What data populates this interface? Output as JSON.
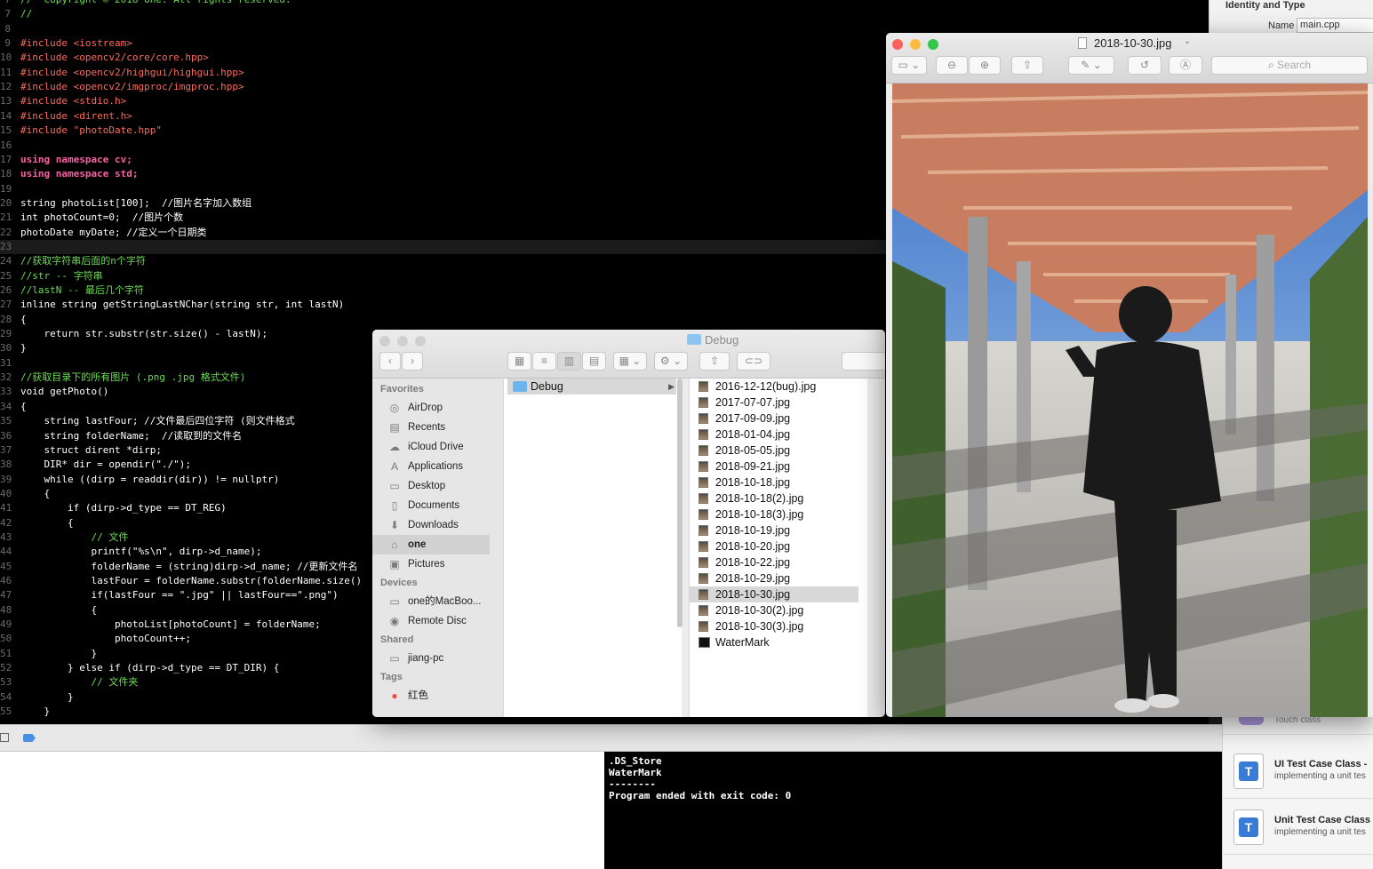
{
  "editor": {
    "lines": [
      {
        "num": "7",
        "text": "//  Copyright © 2018 one. All rights reserved.",
        "cls": "c"
      },
      {
        "num": "7",
        "text": "//",
        "cls": "c"
      },
      {
        "num": "8",
        "text": "",
        "cls": "w"
      },
      {
        "num": "9",
        "text": "#include <iostream>",
        "cls": "p"
      },
      {
        "num": "10",
        "text": "#include <opencv2/core/core.hpp>",
        "cls": "p"
      },
      {
        "num": "11",
        "text": "#include <opencv2/highgui/highgui.hpp>",
        "cls": "p"
      },
      {
        "num": "12",
        "text": "#include <opencv2/imgproc/imgproc.hpp>",
        "cls": "p"
      },
      {
        "num": "13",
        "text": "#include <stdio.h>",
        "cls": "p"
      },
      {
        "num": "14",
        "text": "#include <dirent.h>",
        "cls": "p"
      },
      {
        "num": "15",
        "text": "#include \"photoDate.hpp\"",
        "cls": "p"
      },
      {
        "num": "16",
        "text": "",
        "cls": "w"
      },
      {
        "num": "17",
        "text": "using namespace cv;",
        "cls": "k"
      },
      {
        "num": "18",
        "text": "using namespace std;",
        "cls": "k"
      },
      {
        "num": "19",
        "text": "",
        "cls": "w"
      },
      {
        "num": "20",
        "text": "string photoList[100];  //图片名字加入数组",
        "cls": "w"
      },
      {
        "num": "21",
        "text": "int photoCount=0;  //图片个数",
        "cls": "w"
      },
      {
        "num": "22",
        "text": "photoDate myDate; //定义一个日期类",
        "cls": "w"
      },
      {
        "num": "23",
        "text": "",
        "cls": "w"
      },
      {
        "num": "24",
        "text": "//获取字符串后面的n个字符",
        "cls": "c"
      },
      {
        "num": "25",
        "text": "//str -- 字符串",
        "cls": "c"
      },
      {
        "num": "26",
        "text": "//lastN -- 最后几个字符",
        "cls": "c"
      },
      {
        "num": "27",
        "text": "inline string getStringLastNChar(string str, int lastN)",
        "cls": "w"
      },
      {
        "num": "28",
        "text": "{",
        "cls": "w"
      },
      {
        "num": "29",
        "text": "    return str.substr(str.size() - lastN);",
        "cls": "w"
      },
      {
        "num": "30",
        "text": "}",
        "cls": "w"
      },
      {
        "num": "31",
        "text": "",
        "cls": "w"
      },
      {
        "num": "32",
        "text": "//获取目录下的所有图片 (.png .jpg 格式文件)",
        "cls": "c"
      },
      {
        "num": "33",
        "text": "void getPhoto()",
        "cls": "w"
      },
      {
        "num": "34",
        "text": "{",
        "cls": "w"
      },
      {
        "num": "35",
        "text": "    string lastFour; //文件最后四位字符 (则文件格式",
        "cls": "w"
      },
      {
        "num": "36",
        "text": "    string folderName;  //读取到的文件名",
        "cls": "w"
      },
      {
        "num": "37",
        "text": "    struct dirent *dirp;",
        "cls": "w"
      },
      {
        "num": "38",
        "text": "    DIR* dir = opendir(\"./\");",
        "cls": "w"
      },
      {
        "num": "39",
        "text": "    while ((dirp = readdir(dir)) != nullptr)",
        "cls": "w"
      },
      {
        "num": "40",
        "text": "    {",
        "cls": "w"
      },
      {
        "num": "41",
        "text": "        if (dirp->d_type == DT_REG)",
        "cls": "w"
      },
      {
        "num": "42",
        "text": "        {",
        "cls": "w"
      },
      {
        "num": "43",
        "text": "            // 文件",
        "cls": "c"
      },
      {
        "num": "44",
        "text": "            printf(\"%s\\n\", dirp->d_name);",
        "cls": "w"
      },
      {
        "num": "45",
        "text": "            folderName = (string)dirp->d_name; //更新文件名",
        "cls": "w"
      },
      {
        "num": "46",
        "text": "            lastFour = folderName.substr(folderName.size()",
        "cls": "w"
      },
      {
        "num": "47",
        "text": "            if(lastFour == \".jpg\" || lastFour==\".png\")",
        "cls": "w"
      },
      {
        "num": "48",
        "text": "            {",
        "cls": "w"
      },
      {
        "num": "49",
        "text": "                photoList[photoCount] = folderName;",
        "cls": "w"
      },
      {
        "num": "50",
        "text": "                photoCount++;",
        "cls": "w"
      },
      {
        "num": "51",
        "text": "            }",
        "cls": "w"
      },
      {
        "num": "52",
        "text": "        } else if (dirp->d_type == DT_DIR) {",
        "cls": "w"
      },
      {
        "num": "53",
        "text": "            // 文件夹",
        "cls": "c"
      },
      {
        "num": "54",
        "text": "        }",
        "cls": "w"
      },
      {
        "num": "55",
        "text": "    }",
        "cls": "w"
      }
    ]
  },
  "console": {
    "text": ".DS_Store\nWaterMark\n--------\nProgram ended with exit code: 0"
  },
  "inspector": {
    "heading": "Identity and Type",
    "name_label": "Name",
    "name_value": "main.cpp"
  },
  "library": {
    "partial_label": "Touch class",
    "items": [
      {
        "title": "UI Test Case Class -",
        "subtitle": "implementing a unit tes"
      },
      {
        "title": "Unit Test Case Class",
        "subtitle": "implementing a unit tes"
      }
    ]
  },
  "finder": {
    "title": "Debug",
    "sections": [
      {
        "heading": "Favorites",
        "items": [
          {
            "label": "AirDrop",
            "icon": "airdrop-icon"
          },
          {
            "label": "Recents",
            "icon": "recents-icon"
          },
          {
            "label": "iCloud Drive",
            "icon": "cloud-icon"
          },
          {
            "label": "Applications",
            "icon": "applications-icon"
          },
          {
            "label": "Desktop",
            "icon": "desktop-icon"
          },
          {
            "label": "Documents",
            "icon": "documents-icon"
          },
          {
            "label": "Downloads",
            "icon": "downloads-icon"
          },
          {
            "label": "one",
            "icon": "home-icon",
            "selected": true
          },
          {
            "label": "Pictures",
            "icon": "pictures-icon"
          }
        ]
      },
      {
        "heading": "Devices",
        "items": [
          {
            "label": "one的MacBoo...",
            "icon": "laptop-icon"
          },
          {
            "label": "Remote Disc",
            "icon": "disc-icon"
          }
        ]
      },
      {
        "heading": "Shared",
        "items": [
          {
            "label": "jiang-pc",
            "icon": "monitor-icon"
          }
        ]
      },
      {
        "heading": "Tags",
        "items": [
          {
            "label": "红色",
            "icon": "red-tag-icon"
          }
        ]
      }
    ],
    "column1": [
      {
        "label": "Debug",
        "selected": true
      }
    ],
    "files": [
      {
        "name": "2016-12-12(bug).jpg"
      },
      {
        "name": "2017-07-07.jpg"
      },
      {
        "name": "2017-09-09.jpg"
      },
      {
        "name": "2018-01-04.jpg"
      },
      {
        "name": "2018-05-05.jpg"
      },
      {
        "name": "2018-09-21.jpg"
      },
      {
        "name": "2018-10-18.jpg"
      },
      {
        "name": "2018-10-18(2).jpg"
      },
      {
        "name": "2018-10-18(3).jpg"
      },
      {
        "name": "2018-10-19.jpg"
      },
      {
        "name": "2018-10-20.jpg"
      },
      {
        "name": "2018-10-22.jpg"
      },
      {
        "name": "2018-10-29.jpg"
      },
      {
        "name": "2018-10-30.jpg",
        "selected": true
      },
      {
        "name": "2018-10-30(2).jpg"
      },
      {
        "name": "2018-10-30(3).jpg"
      },
      {
        "name": "WaterMark",
        "exec": true
      }
    ]
  },
  "preview": {
    "title": "2018-10-30.jpg",
    "search_placeholder": "Search"
  },
  "colors": {
    "close": "#fc605c",
    "minimize": "#fdbc40",
    "zoom": "#34c84a",
    "inactive": "#cfcfcf",
    "folder": "#6cb4f0",
    "tag_red": "#f14b43"
  }
}
